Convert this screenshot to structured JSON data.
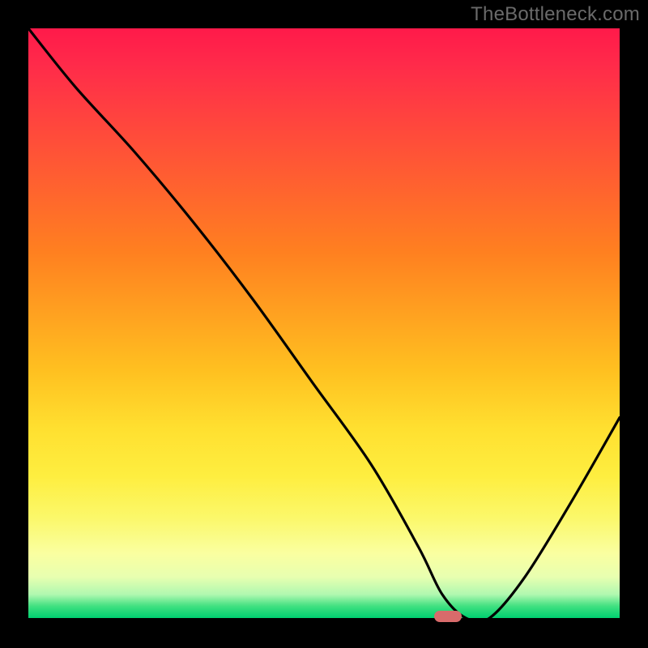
{
  "watermark": "TheBottleneck.com",
  "chart_data": {
    "type": "line",
    "title": "",
    "xlabel": "",
    "ylabel": "",
    "xlim": [
      0,
      100
    ],
    "ylim": [
      0,
      100
    ],
    "x": [
      0,
      8,
      18,
      28,
      38,
      48,
      58,
      66,
      70,
      74,
      78,
      84,
      92,
      100
    ],
    "values": [
      100,
      90,
      79,
      67,
      54,
      40,
      26,
      12,
      4,
      0,
      0,
      7,
      20,
      34
    ],
    "marker": {
      "x": 71,
      "y": 0
    },
    "note": "Values estimated from pixel positions; y=0 is bottom (green), y=100 is top (red)."
  },
  "colors": {
    "curve": "#000000",
    "marker": "#d86b6b",
    "frame": "#000000"
  }
}
